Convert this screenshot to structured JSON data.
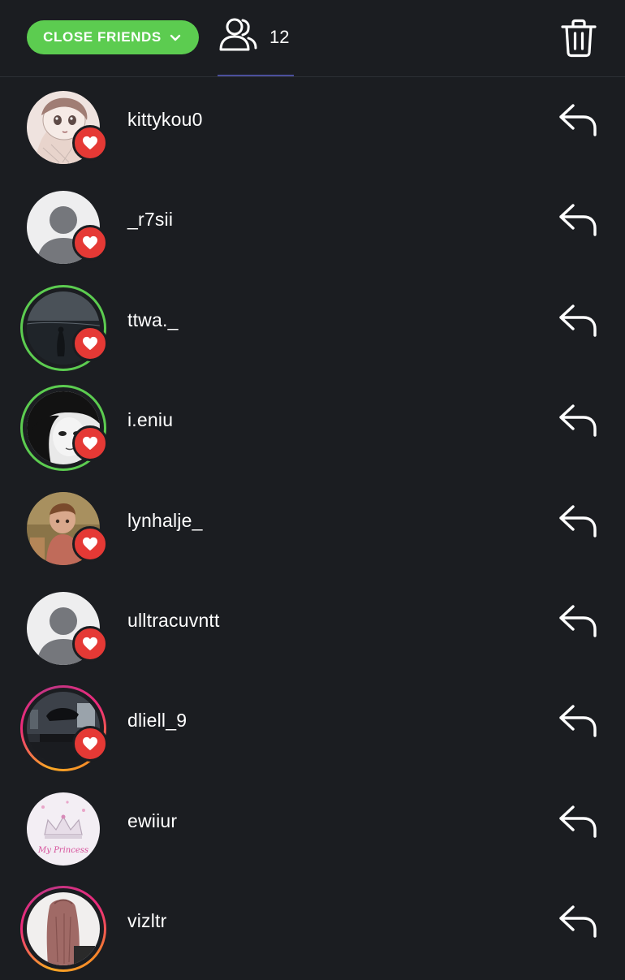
{
  "header": {
    "audience_label": "CLOSE FRIENDS",
    "viewer_count": "12",
    "icons": {
      "dropdown": "chevron-down-icon",
      "viewers": "viewers-icon",
      "delete": "trash-icon"
    },
    "accent_color": "#5ccc50"
  },
  "viewers": [
    {
      "username": "kittykou0",
      "avatar": "photo",
      "ring": "none",
      "close_friend": true
    },
    {
      "username": "_r7sii",
      "avatar": "default",
      "ring": "none",
      "close_friend": true
    },
    {
      "username": "ttwa._",
      "avatar": "photo",
      "ring": "green",
      "close_friend": true
    },
    {
      "username": "i.eniu",
      "avatar": "photo",
      "ring": "green",
      "close_friend": true
    },
    {
      "username": "lynhalje_",
      "avatar": "photo",
      "ring": "none",
      "close_friend": true
    },
    {
      "username": "ulltracuvntt",
      "avatar": "default",
      "ring": "none",
      "close_friend": true
    },
    {
      "username": "dliell_9",
      "avatar": "photo",
      "ring": "gradient",
      "close_friend": true
    },
    {
      "username": "ewiiur",
      "avatar": "photo",
      "ring": "none",
      "close_friend": false,
      "avatar_text": "My Princess"
    },
    {
      "username": "vizltr",
      "avatar": "photo",
      "ring": "gradient",
      "close_friend": false
    }
  ],
  "colors": {
    "background": "#1b1d21",
    "close_friend_badge": "#e53935",
    "story_ring_gradient": [
      "#f9a825",
      "#ee2a7b",
      "#c13584"
    ]
  }
}
